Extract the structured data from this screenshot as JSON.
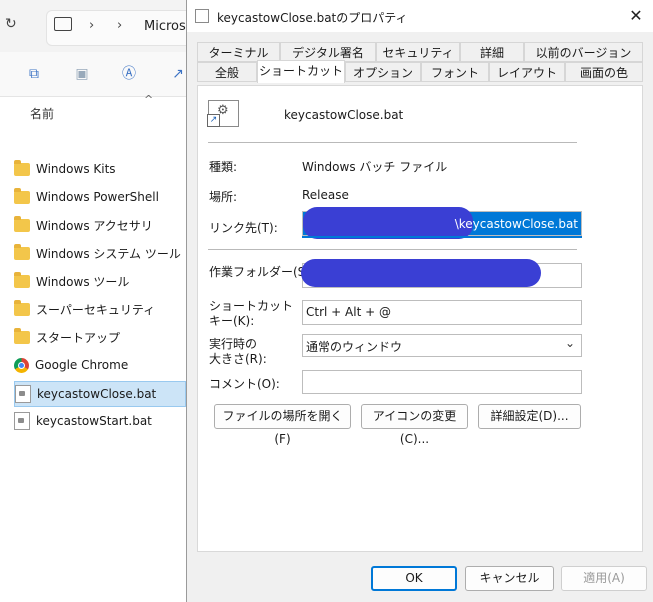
{
  "explorer": {
    "address_label": "Microsoft",
    "column_header": "名前",
    "items": [
      {
        "name": "Windows Kits",
        "icon": "folder-icon"
      },
      {
        "name": "Windows PowerShell",
        "icon": "folder-icon"
      },
      {
        "name": "Windows アクセサリ",
        "icon": "folder-icon"
      },
      {
        "name": "Windows システム ツール",
        "icon": "folder-icon"
      },
      {
        "name": "Windows ツール",
        "icon": "folder-icon"
      },
      {
        "name": "スーパーセキュリティ",
        "icon": "folder-icon"
      },
      {
        "name": "スタートアップ",
        "icon": "folder-icon"
      },
      {
        "name": "Google Chrome",
        "icon": "chrome-icon"
      },
      {
        "name": "keycastowClose.bat",
        "icon": "bat-file-icon",
        "selected": true
      },
      {
        "name": "keycastowStart.bat",
        "icon": "bat-file-icon"
      }
    ]
  },
  "dialog": {
    "title": "keycastowClose.batのプロパティ",
    "close_glyph": "✕",
    "tabs_row1": [
      "ターミナル",
      "デジタル署名",
      "セキュリティ",
      "詳細",
      "以前のバージョン"
    ],
    "tabs_row2": [
      "全般",
      "ショートカット",
      "オプション",
      "フォント",
      "レイアウト",
      "画面の色"
    ],
    "active_tab": "ショートカット",
    "file_name": "keycastowClose.bat",
    "fields": {
      "type_label": "種類:",
      "type_value": "Windows バッチ ファイル",
      "location_label": "場所:",
      "location_value": "Release",
      "target_label": "リンク先(T):",
      "target_value_visible": "\\keycastowClose.bat",
      "workdir_label": "作業フォルダー(S):",
      "hotkey_label_line1": "ショートカット",
      "hotkey_label_line2": "キー(K):",
      "hotkey_value": "Ctrl + Alt + @",
      "run_label_line1": "実行時の",
      "run_label_line2": "大きさ(R):",
      "run_value": "通常のウィンドウ",
      "comment_label": "コメント(O):",
      "comment_value": ""
    },
    "buttons": {
      "open_location": "ファイルの場所を開く(F)",
      "change_icon": "アイコンの変更(C)...",
      "advanced": "詳細設定(D)...",
      "ok": "OK",
      "cancel": "キャンセル",
      "apply": "適用(A)"
    }
  }
}
